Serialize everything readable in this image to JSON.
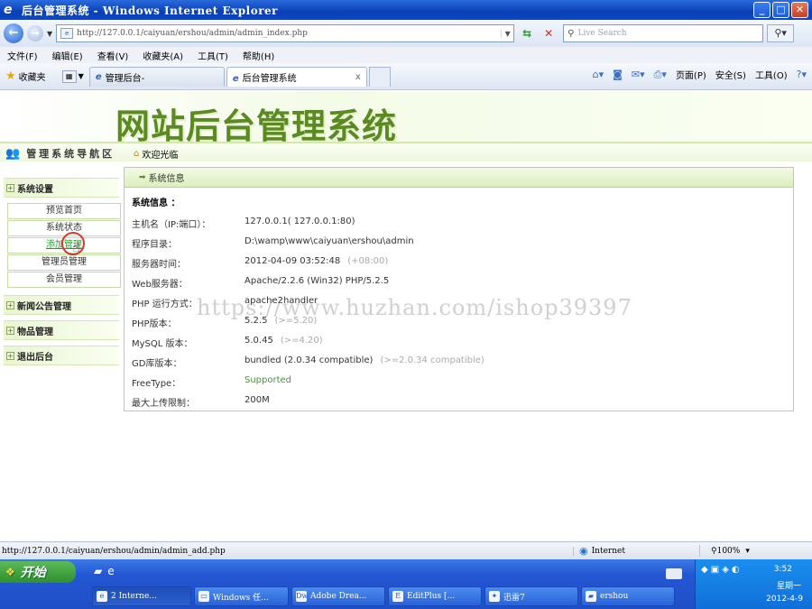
{
  "window": {
    "title": "后台管理系统 - Windows Internet Explorer",
    "minimize": "_",
    "maximize": "□",
    "close": "✕"
  },
  "address": {
    "url": "http://127.0.0.1/caiyuan/ershou/admin/admin_index.php",
    "search_placeholder": "Live Search"
  },
  "menu": [
    "文件(F)",
    "编辑(E)",
    "查看(V)",
    "收藏夹(A)",
    "工具(T)",
    "帮助(H)"
  ],
  "favorites_label": "收藏夹",
  "tabs": [
    {
      "label": "管理后台-"
    },
    {
      "label": "后台管理系统",
      "close": "x"
    }
  ],
  "commands": {
    "page": "页面(P)",
    "safety": "安全(S)",
    "tools": "工具(O)"
  },
  "page": {
    "banner_title": "网站后台管理系统",
    "nav_heading": "管理系统导航区",
    "welcome": "欢迎光临"
  },
  "sidebar": {
    "sections": [
      {
        "label": "系统设置"
      },
      {
        "label": "新闻公告管理"
      },
      {
        "label": "物品管理"
      },
      {
        "label": "退出后台"
      }
    ],
    "items": [
      {
        "label": "预览首页"
      },
      {
        "label": "系统状态"
      },
      {
        "label": "添加管理"
      },
      {
        "label": "管理员管理"
      },
      {
        "label": "会员管理"
      }
    ]
  },
  "panel": {
    "title": "系统信息",
    "heading": "系统信息 ：",
    "rows": [
      {
        "label": "主机名（IP:端口）：",
        "value": "127.0.0.1( 127.0.0.1:80)",
        "extra": ""
      },
      {
        "label": "程序目录：",
        "value": "D:\\wamp\\www\\caiyuan\\ershou\\admin",
        "extra": ""
      },
      {
        "label": "服务器时间：",
        "value": "2012-04-09 03:52:48",
        "extra": "(+08:00)"
      },
      {
        "label": "Web服务器：",
        "value": "Apache/2.2.6 (Win32) PHP/5.2.5",
        "extra": ""
      },
      {
        "label": "PHP 运行方式：",
        "value": "apache2handler",
        "extra": ""
      },
      {
        "label": "PHP版本：",
        "value": "5.2.5",
        "extra": "(>=5.20)"
      },
      {
        "label": "MySQL 版本：",
        "value": "5.0.45",
        "extra": "(>=4.20)"
      },
      {
        "label": "GD库版本：",
        "value": "bundled (2.0.34 compatible)",
        "extra": "(>=2.0.34 compatible)"
      },
      {
        "label": "FreeType：",
        "value": "Supported",
        "extra": ""
      },
      {
        "label": "最大上传限制：",
        "value": "200M",
        "extra": ""
      }
    ]
  },
  "watermark": "https://www.huzhan.com/ishop39397",
  "status": {
    "url": "http://127.0.0.1/caiyuan/ershou/admin/admin_add.php",
    "zone": "Internet",
    "zoom": "100%"
  },
  "taskbar": {
    "start": "开始",
    "buttons": [
      {
        "label": "2 Interne..."
      },
      {
        "label": "Windows 任..."
      },
      {
        "label": "Adobe Drea..."
      },
      {
        "label": "EditPlus [..."
      },
      {
        "label": "迅雷7"
      },
      {
        "label": "ershou"
      }
    ],
    "clock": "3:52",
    "weekday": "星期一",
    "date": "2012-4-9"
  },
  "colors": {
    "accent_green": "#5b8a21",
    "link_green": "#3c9a2d",
    "xp_blue": "#2457d3"
  }
}
